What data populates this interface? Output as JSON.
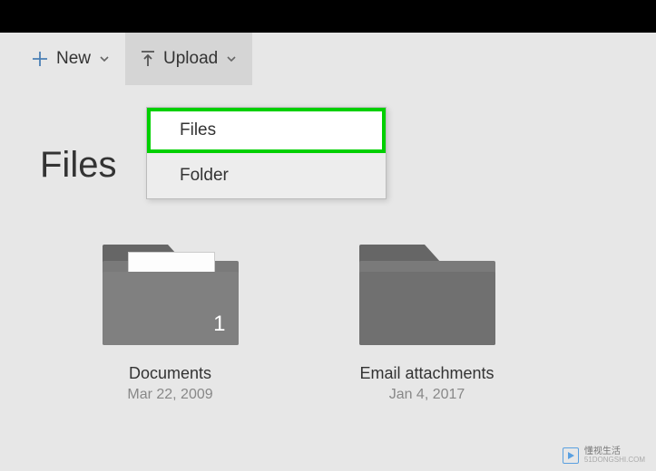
{
  "toolbar": {
    "new_label": "New",
    "upload_label": "Upload"
  },
  "dropdown": {
    "items": [
      {
        "label": "Files",
        "highlighted": true
      },
      {
        "label": "Folder",
        "highlighted": false
      }
    ]
  },
  "page": {
    "title": "Files"
  },
  "folders": [
    {
      "name": "Documents",
      "date": "Mar 22, 2009",
      "count": "1",
      "has_paper": true
    },
    {
      "name": "Email attachments",
      "date": "Jan 4, 2017",
      "count": "",
      "has_paper": false
    }
  ],
  "watermark": {
    "brand_cn": "懂视生活",
    "url": "51DONGSHI.COM"
  }
}
